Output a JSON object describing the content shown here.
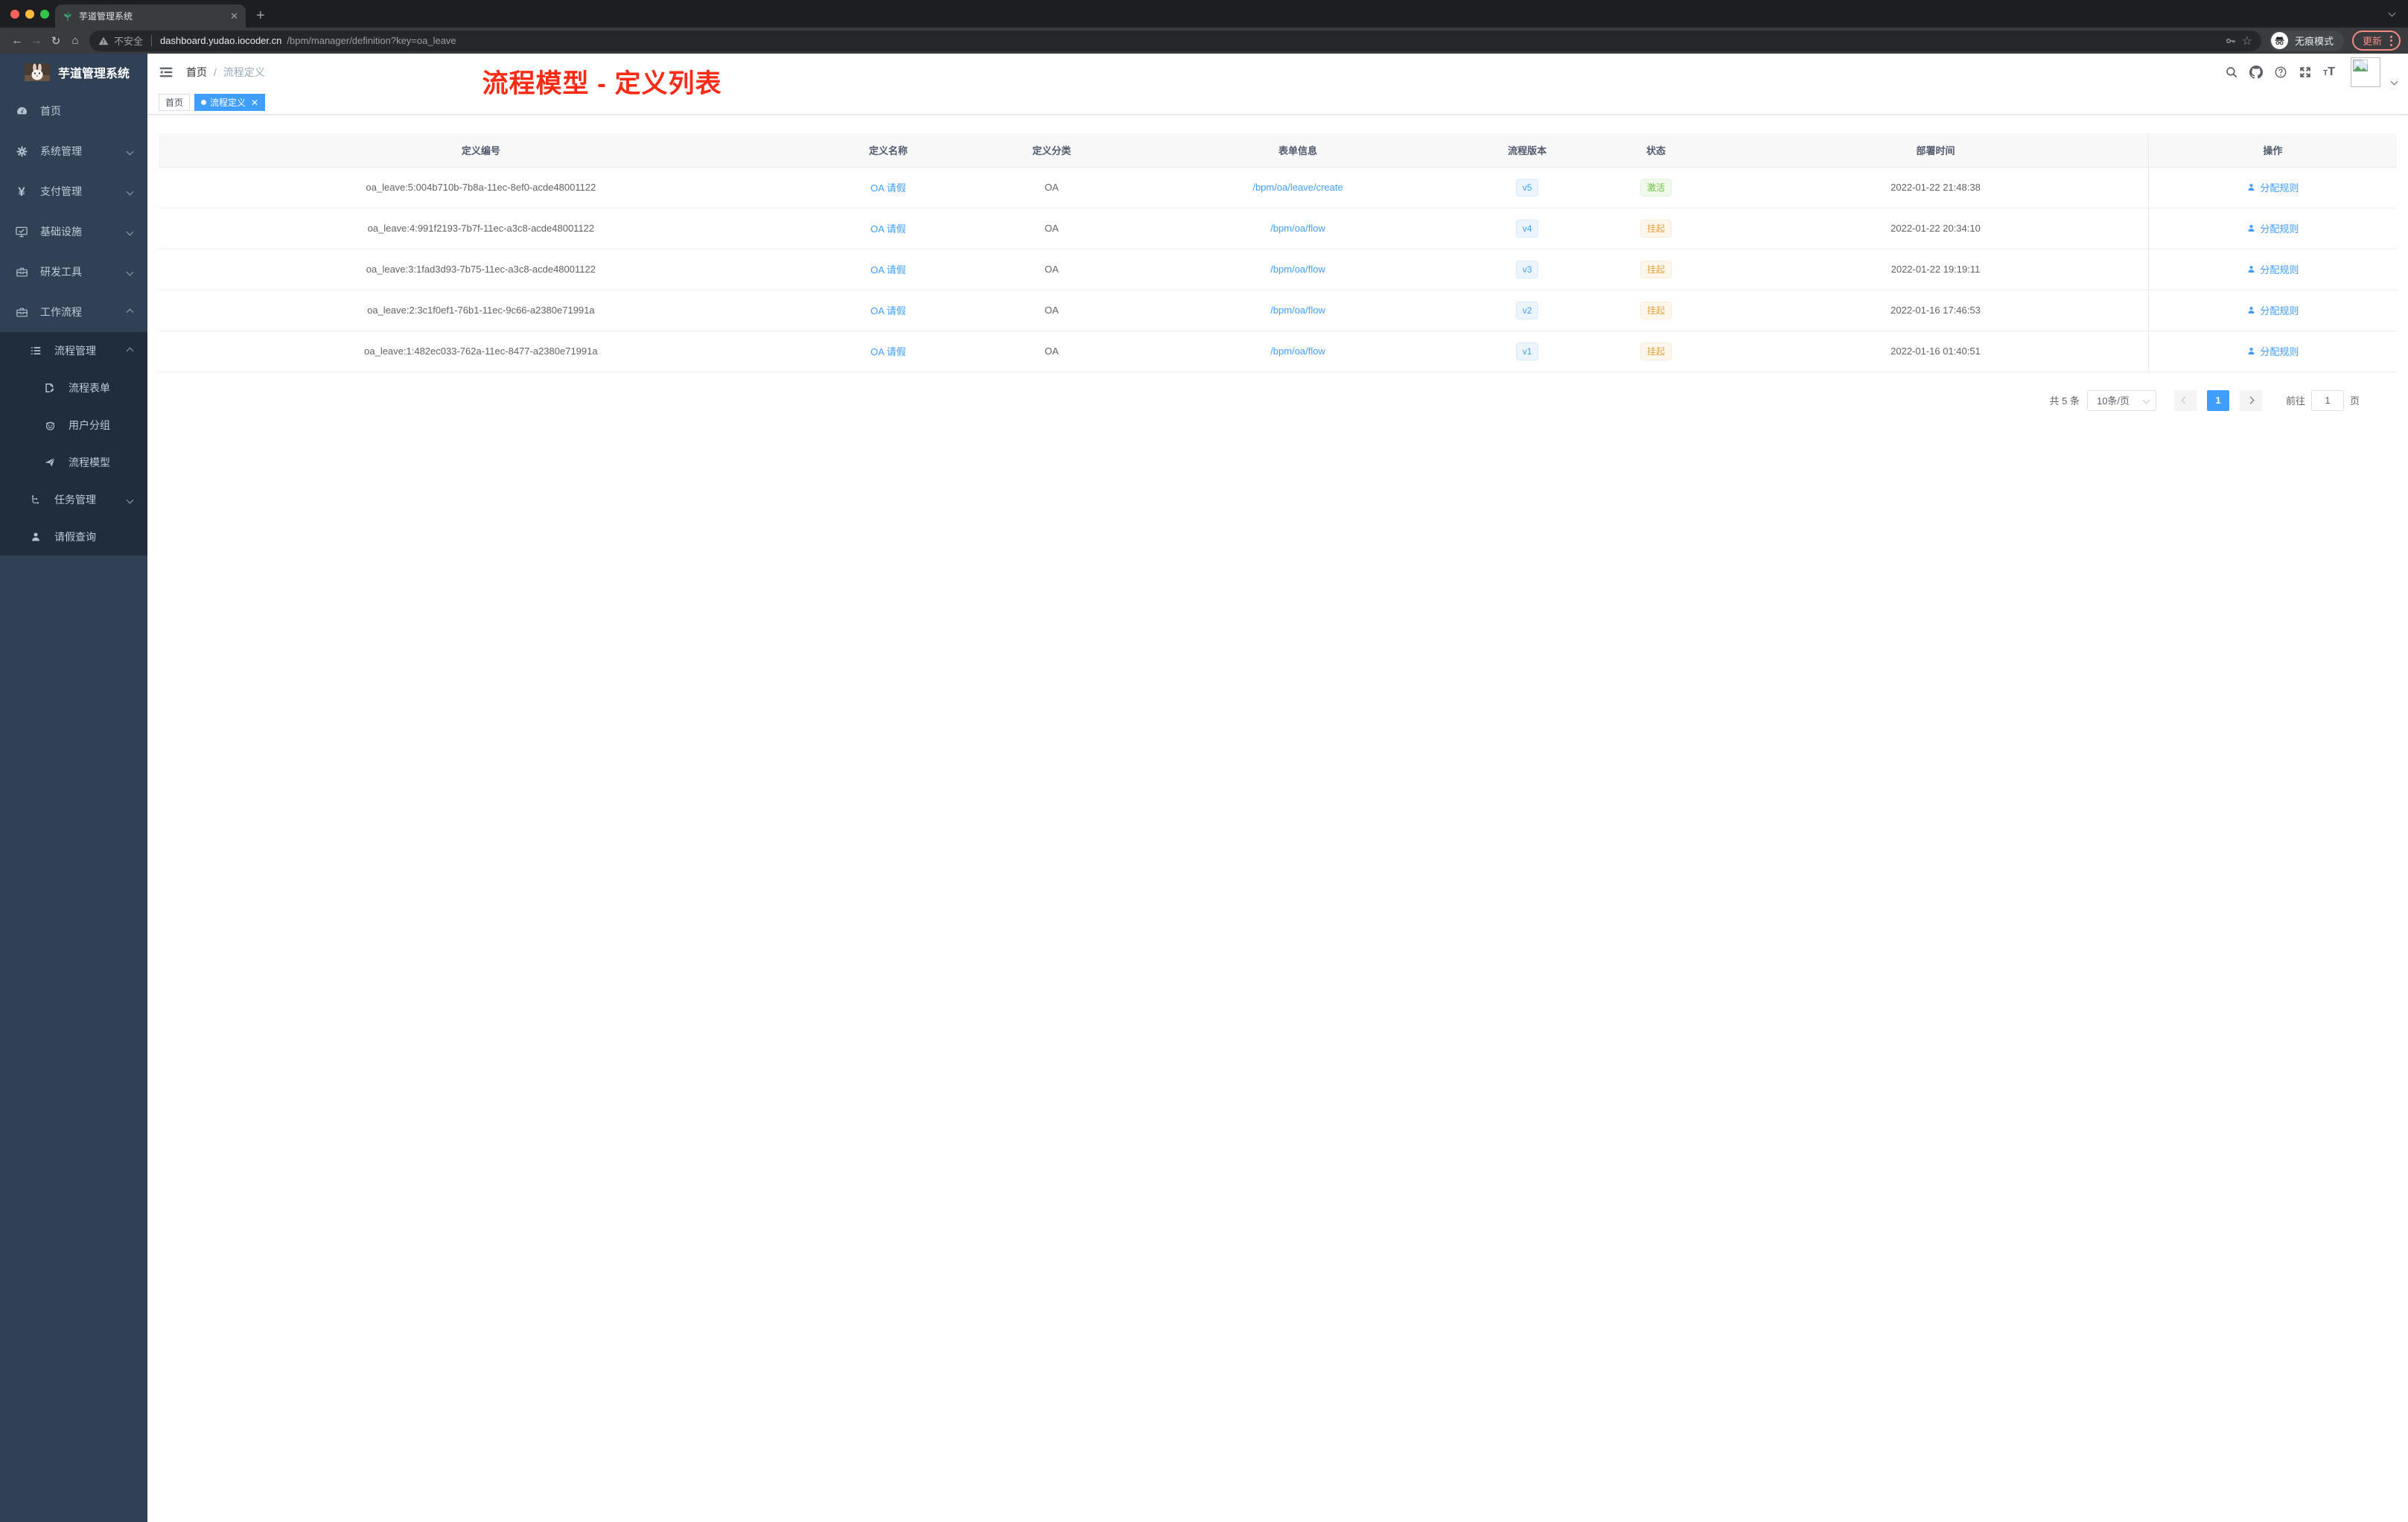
{
  "browser": {
    "tab_title": "芋道管理系统",
    "security_label": "不安全",
    "url_host": "dashboard.yudao.iocoder.cn",
    "url_path": "/bpm/manager/definition?key=oa_leave",
    "incognito_label": "无痕模式",
    "update_label": "更新"
  },
  "sidebar": {
    "logo_title": "芋道管理系统",
    "items": [
      {
        "key": "home",
        "label": "首页",
        "icon": "dashboard-icon"
      },
      {
        "key": "system",
        "label": "系统管理",
        "icon": "gear-icon",
        "chev": "down"
      },
      {
        "key": "payment",
        "label": "支付管理",
        "icon": "yen-icon",
        "chev": "down"
      },
      {
        "key": "infra",
        "label": "基础设施",
        "icon": "monitor-icon",
        "chev": "down"
      },
      {
        "key": "devtools",
        "label": "研发工具",
        "icon": "toolbox-icon",
        "chev": "down"
      },
      {
        "key": "workflow",
        "label": "工作流程",
        "icon": "briefcase-icon",
        "chev": "up"
      }
    ],
    "submenu": [
      {
        "key": "process-mgmt",
        "label": "流程管理",
        "icon": "list-icon",
        "chev": "up",
        "level": 1
      },
      {
        "key": "process-form",
        "label": "流程表单",
        "icon": "form-icon",
        "level": 2
      },
      {
        "key": "user-group",
        "label": "用户分组",
        "icon": "group-icon",
        "level": 2
      },
      {
        "key": "process-model",
        "label": "流程模型",
        "icon": "plane-icon",
        "level": 2
      },
      {
        "key": "task-mgmt",
        "label": "任务管理",
        "icon": "tasks-icon",
        "chev": "down",
        "level": 1
      },
      {
        "key": "leave-query",
        "label": "请假查询",
        "icon": "user-icon",
        "level": 1
      }
    ]
  },
  "header": {
    "breadcrumb": [
      "首页",
      "流程定义"
    ],
    "breadcrumb_separator": "/",
    "annotation": "流程模型 - 定义列表"
  },
  "tags": [
    {
      "label": "首页",
      "active": false,
      "closable": false
    },
    {
      "label": "流程定义",
      "active": true,
      "closable": true
    }
  ],
  "table": {
    "columns": [
      "定义编号",
      "定义名称",
      "定义分类",
      "表单信息",
      "流程版本",
      "状态",
      "部署时间",
      "操作"
    ],
    "rows": [
      {
        "id": "oa_leave:5:004b710b-7b8a-11ec-8ef0-acde48001122",
        "name": "OA 请假",
        "category": "OA",
        "form": "/bpm/oa/leave/create",
        "version": "v5",
        "status": "激活",
        "status_type": "success",
        "time": "2022-01-22 21:48:38",
        "action": "分配规则"
      },
      {
        "id": "oa_leave:4:991f2193-7b7f-11ec-a3c8-acde48001122",
        "name": "OA 请假",
        "category": "OA",
        "form": "/bpm/oa/flow",
        "version": "v4",
        "status": "挂起",
        "status_type": "warning",
        "time": "2022-01-22 20:34:10",
        "action": "分配规则"
      },
      {
        "id": "oa_leave:3:1fad3d93-7b75-11ec-a3c8-acde48001122",
        "name": "OA 请假",
        "category": "OA",
        "form": "/bpm/oa/flow",
        "version": "v3",
        "status": "挂起",
        "status_type": "warning",
        "time": "2022-01-22 19:19:11",
        "action": "分配规则"
      },
      {
        "id": "oa_leave:2:3c1f0ef1-76b1-11ec-9c66-a2380e71991a",
        "name": "OA 请假",
        "category": "OA",
        "form": "/bpm/oa/flow",
        "version": "v2",
        "status": "挂起",
        "status_type": "warning",
        "time": "2022-01-16 17:46:53",
        "action": "分配规则"
      },
      {
        "id": "oa_leave:1:482ec033-762a-11ec-8477-a2380e71991a",
        "name": "OA 请假",
        "category": "OA",
        "form": "/bpm/oa/flow",
        "version": "v1",
        "status": "挂起",
        "status_type": "warning",
        "time": "2022-01-16 01:40:51",
        "action": "分配规则"
      }
    ]
  },
  "pagination": {
    "total_label": "共 5 条",
    "page_size": "10条/页",
    "current_page": "1",
    "goto_label": "前往",
    "goto_value": "1",
    "page_label": "页"
  },
  "colors": {
    "accent": "#409eff",
    "success": "#67c23a",
    "warning": "#e6a23c",
    "annotation_red": "#fb2b16",
    "sidebar_bg": "#304156",
    "submenu_bg": "#1f2d3d",
    "tag_active_bg": "#409eff"
  }
}
